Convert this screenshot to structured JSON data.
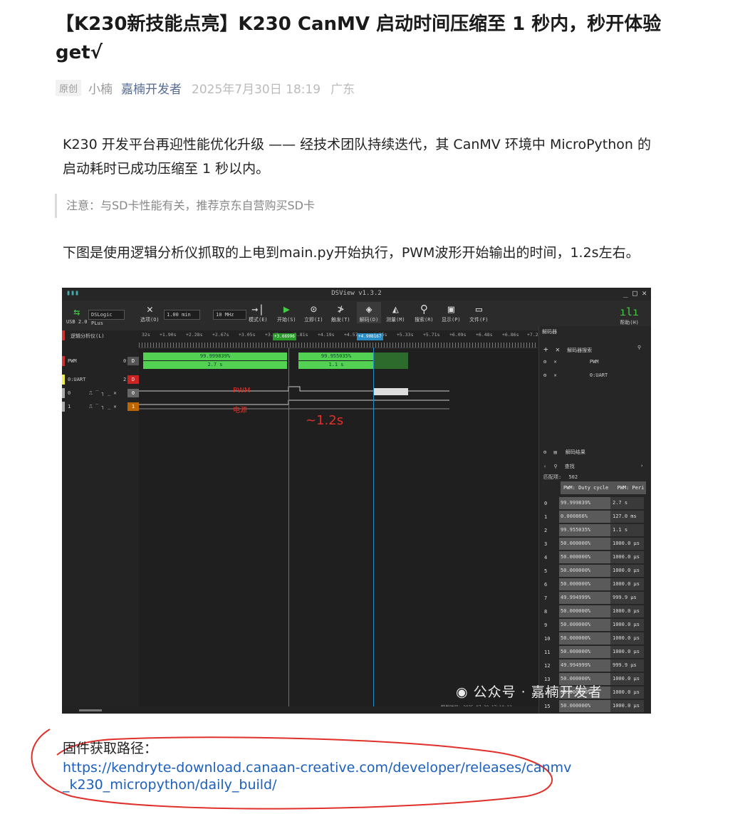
{
  "article": {
    "title": "【K230新技能点亮】K230 CanMV 启动时间压缩至 1 秒内，秒开体验 get√",
    "tag": "原创",
    "author": "小楠",
    "account": "嘉楠开发者",
    "date": "2025年7月30日 18:19",
    "location": "广东",
    "intro": "K230 开发平台再迎性能优化升级 —— 经技术团队持续迭代，其 CanMV 环境中 MicroPython 的启动耗时已成功压缩至 1 秒以内。",
    "note": "注意：与SD卡性能有关，推荐京东自营购买SD卡",
    "figure_caption": "下图是使用逻辑分析仪抓取的上电到main.py开始执行，PWM波形开始输出的时间，1.2s左右。",
    "firmware_label": "固件获取路径：",
    "firmware_link": "https://kendryte-download.canaan-creative.com/developer/releases/canmv_k230_micropython/daily_build/",
    "watermark": "公众号 · 嘉楠开发者"
  },
  "dsview": {
    "window_title": "DSView v1.3.2",
    "usb": "USB 2.0",
    "device": "DSLogic PLus",
    "toolbar": {
      "options": "选项(O)",
      "duration": "1.00 min",
      "rate": "10 MHz",
      "mode": "模式(E)",
      "start": "开始(S)",
      "instant": "立即(I)",
      "trigger": "触发(T)",
      "decode": "解码(D)",
      "measure": "测量(M)",
      "search": "搜索(R)",
      "display": "显示(P)",
      "file": "文件(F)",
      "help": "帮助(H)"
    },
    "ruler": {
      "ticks": [
        "32s",
        "+1.90s",
        "+2.28s",
        "+2.67s",
        "+3.05s",
        "+3.43s",
        "+3.81s",
        "+4.19s",
        "+4.57s",
        "+4.95s",
        "+5.33s",
        "+5.71s",
        "+6.09s",
        "+6.48s",
        "+6.86s",
        "+7.2"
      ],
      "cursor1": "+3.66996",
      "cursor2": "+4.908167"
    },
    "channels": {
      "group": "逻辑分析仪(L)",
      "pwm_decoder": "PWM",
      "uart_decoder": "0:UART",
      "ch0": "0",
      "ch1": "1",
      "pwm_num": "0",
      "uart_num": "2",
      "label_d": "D",
      "label_0": "0",
      "label_1": "1"
    },
    "wave": {
      "seg1_duty": "99.999839%",
      "seg1_period": "2.7 s",
      "seg2_duty": "99.955035%",
      "seg2_period": "1.1 s",
      "annot_pwm": "PWM",
      "annot_power": "电源",
      "annot_time": "~1.2s"
    },
    "decoder_panel": {
      "title": "解码器",
      "search_placeholder": "解码器搜索",
      "row1": "PWM",
      "row2": "0:UART",
      "results_title": "解码结果",
      "find_placeholder": "查找",
      "match_label": "匹配项:",
      "match_count": "502",
      "col1": "PWM: Duty cycle",
      "col2": "PWM: Peri"
    },
    "results": [
      {
        "idx": "0",
        "duty": "99.999839%",
        "period": "2.7 s"
      },
      {
        "idx": "1",
        "duty": "0.000866%",
        "period": "127.0 ms"
      },
      {
        "idx": "2",
        "duty": "99.955035%",
        "period": "1.1 s"
      },
      {
        "idx": "3",
        "duty": "50.000000%",
        "period": "1000.0 µs"
      },
      {
        "idx": "4",
        "duty": "50.000000%",
        "period": "1000.0 µs"
      },
      {
        "idx": "5",
        "duty": "50.000000%",
        "period": "1000.0 µs"
      },
      {
        "idx": "6",
        "duty": "50.000000%",
        "period": "1000.0 µs"
      },
      {
        "idx": "7",
        "duty": "49.994999%",
        "period": "999.9 µs"
      },
      {
        "idx": "8",
        "duty": "50.000000%",
        "period": "1000.0 µs"
      },
      {
        "idx": "9",
        "duty": "50.000000%",
        "period": "1000.0 µs"
      },
      {
        "idx": "10",
        "duty": "50.000000%",
        "period": "1000.0 µs"
      },
      {
        "idx": "11",
        "duty": "50.000000%",
        "period": "1000.0 µs"
      },
      {
        "idx": "12",
        "duty": "49.994999%",
        "period": "999.9 µs"
      },
      {
        "idx": "13",
        "duty": "50.000000%",
        "period": "1000.0 µs"
      },
      {
        "idx": "14",
        "duty": "50.000000%",
        "period": "1000.0 µs"
      },
      {
        "idx": "15",
        "duty": "50.000000%",
        "period": "1000.0 µs"
      }
    ],
    "status_time": "触发时间: 2025-07-30 17:10:12"
  },
  "colors": {
    "link": "#1b5fbf",
    "account": "#576b95",
    "annotation": "#e0302a",
    "pwm_bar": "#49c94a"
  }
}
